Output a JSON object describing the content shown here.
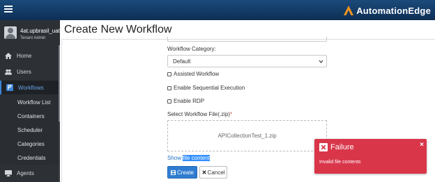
{
  "header": {
    "brand_name": "AutomationEdge",
    "brand_color": "#f7941d"
  },
  "sidebar": {
    "user_name": "4at.upbrasil_uat",
    "user_role": "Tenant Admin",
    "items": [
      {
        "label": "Home",
        "icon": "home-icon"
      },
      {
        "label": "Users",
        "icon": "users-icon"
      },
      {
        "label": "Workflows",
        "icon": "workflow-icon"
      },
      {
        "label": "Agents",
        "icon": "monitor-icon"
      }
    ],
    "sub_items": [
      "Workflow List",
      "Containers",
      "Scheduler",
      "Categories",
      "Credentials"
    ]
  },
  "main": {
    "title": "Create New Workflow",
    "category_label": "Workflow Category:",
    "category_value": "Default",
    "checkboxes": [
      "Assisted Workflow",
      "Enable Sequential Execution",
      "Enable RDP"
    ],
    "file_label": "Select Workflow File(.zip)",
    "required_mark": "*",
    "file_name": "APICollectionTest_1.zip",
    "show_link_plain": "Show ",
    "show_link_selected": "file content",
    "create_label": "Create",
    "cancel_label": "Cancel"
  },
  "toast": {
    "title": "Failure",
    "message": "Invalid file contents",
    "close": "×",
    "color": "#d9364a"
  }
}
